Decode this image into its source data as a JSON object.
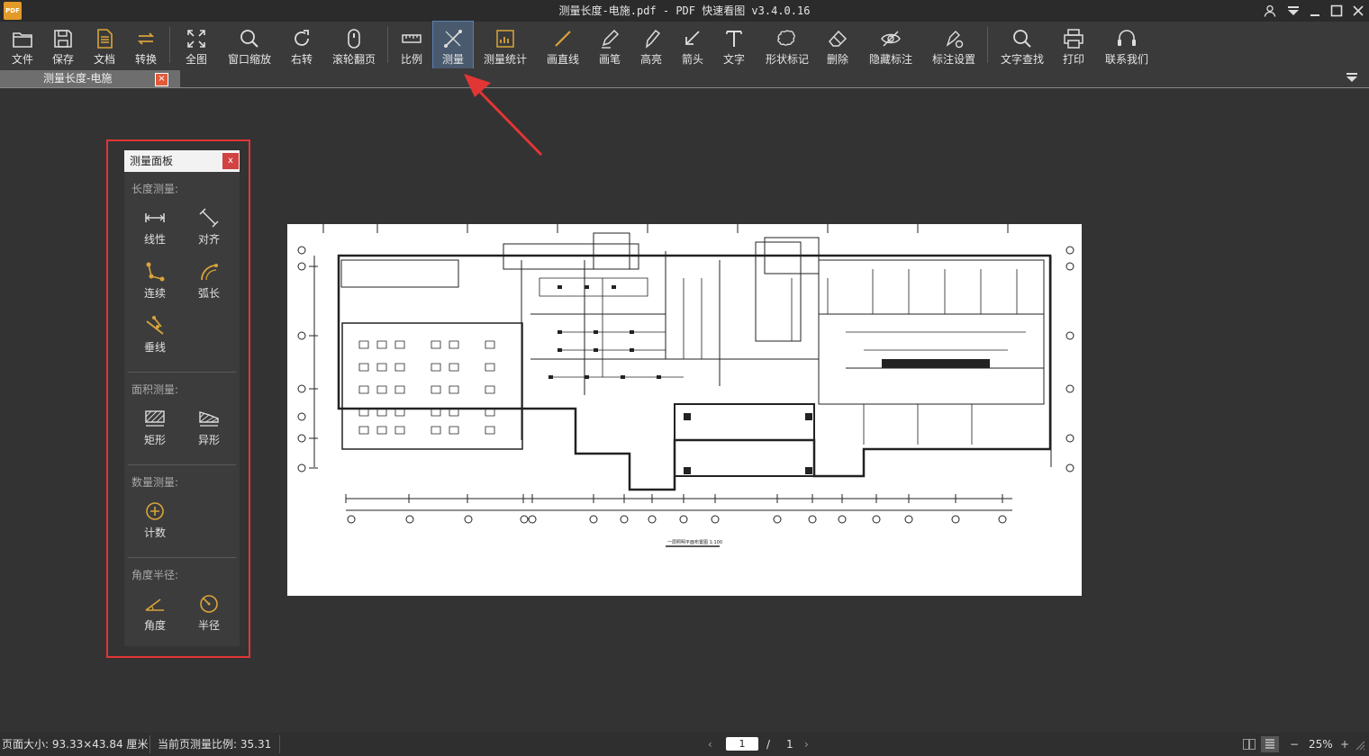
{
  "window": {
    "title": "测量长度-电施.pdf - PDF 快速看图 v3.4.0.16",
    "logo_text": "PDF"
  },
  "toolbar": {
    "items": [
      {
        "id": "file",
        "label": "文件",
        "icon": "folder-icon"
      },
      {
        "id": "save",
        "label": "保存",
        "icon": "save-icon"
      },
      {
        "id": "docs",
        "label": "文档",
        "icon": "document-icon"
      },
      {
        "id": "convert",
        "label": "转换",
        "icon": "convert-icon"
      },
      {
        "id": "fit",
        "label": "全图",
        "icon": "fullscreen-icon"
      },
      {
        "id": "zoom",
        "label": "窗口缩放",
        "icon": "zoom-icon"
      },
      {
        "id": "rotate",
        "label": "右转",
        "icon": "rotate-right-icon"
      },
      {
        "id": "scroll",
        "label": "滚轮翻页",
        "icon": "mouse-icon"
      },
      {
        "id": "scale",
        "label": "比例",
        "icon": "ruler-icon"
      },
      {
        "id": "measure",
        "label": "测量",
        "icon": "measure-icon",
        "active": true
      },
      {
        "id": "stats",
        "label": "测量统计",
        "icon": "stats-icon"
      },
      {
        "id": "line",
        "label": "画直线",
        "icon": "line-icon"
      },
      {
        "id": "pen",
        "label": "画笔",
        "icon": "pen-icon"
      },
      {
        "id": "highlight",
        "label": "高亮",
        "icon": "highlighter-icon"
      },
      {
        "id": "arrow",
        "label": "箭头",
        "icon": "arrow-icon"
      },
      {
        "id": "text",
        "label": "文字",
        "icon": "text-icon"
      },
      {
        "id": "shape",
        "label": "形状标记",
        "icon": "cloud-shape-icon"
      },
      {
        "id": "erase",
        "label": "删除",
        "icon": "eraser-icon"
      },
      {
        "id": "hide",
        "label": "隐藏标注",
        "icon": "eye-off-icon"
      },
      {
        "id": "annot-settings",
        "label": "标注设置",
        "icon": "annotation-settings-icon"
      },
      {
        "id": "find",
        "label": "文字查找",
        "icon": "search-icon"
      },
      {
        "id": "print",
        "label": "打印",
        "icon": "printer-icon"
      },
      {
        "id": "contact",
        "label": "联系我们",
        "icon": "headset-icon"
      }
    ]
  },
  "tabs": [
    {
      "label": "测量长度-电施",
      "close": "×",
      "active": true
    }
  ],
  "panel": {
    "title": "测量面板",
    "close": "x",
    "sections": {
      "length": {
        "title": "长度测量:",
        "tools": [
          {
            "label": "线性",
            "icon": "linear-measure-icon"
          },
          {
            "label": "对齐",
            "icon": "aligned-measure-icon"
          },
          {
            "label": "连续",
            "icon": "continuous-measure-icon"
          },
          {
            "label": "弧长",
            "icon": "arc-length-icon"
          },
          {
            "label": "垂线",
            "icon": "perpendicular-icon"
          }
        ]
      },
      "area": {
        "title": "面积测量:",
        "tools": [
          {
            "label": "矩形",
            "icon": "rectangle-area-icon"
          },
          {
            "label": "异形",
            "icon": "irregular-area-icon"
          }
        ]
      },
      "count": {
        "title": "数量测量:",
        "tools": [
          {
            "label": "计数",
            "icon": "count-icon"
          }
        ]
      },
      "angle": {
        "title": "角度半径:",
        "tools": [
          {
            "label": "角度",
            "icon": "angle-icon"
          },
          {
            "label": "半径",
            "icon": "radius-icon"
          }
        ]
      }
    }
  },
  "document": {
    "drawing_caption": "一层照明平面布置图 1:100"
  },
  "status": {
    "page_size": "页面大小: 93.33×43.84 厘米",
    "scale": "当前页测量比例: 35.31",
    "current_page": "1",
    "page_sep": "/",
    "total_pages": "1",
    "zoom": "25%",
    "prev": "‹",
    "next": "›",
    "zoom_out": "−",
    "zoom_in": "+"
  },
  "colors": {
    "accent_gold": "#d9a43a",
    "highlight_red": "#e23535",
    "active_tool_bg": "#4a5a6e"
  }
}
